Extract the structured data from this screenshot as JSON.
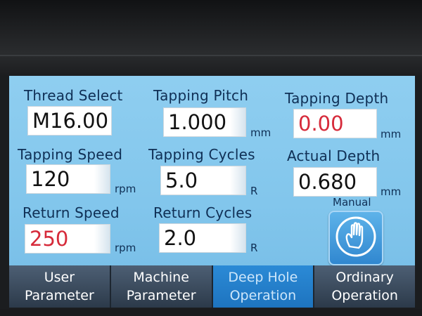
{
  "params": {
    "thread_select": {
      "label": "Thread Select",
      "value": "M16.00"
    },
    "tapping_pitch": {
      "label": "Tapping Pitch",
      "value": "1.000",
      "unit": "mm"
    },
    "tapping_depth": {
      "label": "Tapping Depth",
      "value": "0.00",
      "unit": "mm"
    },
    "tapping_speed": {
      "label": "Tapping Speed",
      "value": "120",
      "unit": "rpm"
    },
    "tapping_cycles": {
      "label": "Tapping Cycles",
      "value": "5.0",
      "unit": "R"
    },
    "actual_depth": {
      "label": "Actual Depth",
      "value": "0.680",
      "unit": "mm"
    },
    "return_speed": {
      "label": "Return Speed",
      "value": "250",
      "unit": "rpm"
    },
    "return_cycles": {
      "label": "Return Cycles",
      "value": "2.0",
      "unit": "R"
    }
  },
  "manual": {
    "label": "Manual",
    "icon": "hand-icon"
  },
  "tabs": [
    {
      "line1": "User",
      "line2": "Parameter",
      "active": false
    },
    {
      "line1": "Machine",
      "line2": "Parameter",
      "active": false
    },
    {
      "line1": "Deep Hole",
      "line2": "Operation",
      "active": true
    },
    {
      "line1": "Ordinary",
      "line2": "Operation",
      "active": false
    }
  ],
  "colors": {
    "screen_bg": "#86c9ee",
    "label_text": "#0f2f55",
    "highlight_value": "#d62a3a",
    "tab_inactive": "#3b4a5c",
    "tab_active": "#2580cb"
  }
}
